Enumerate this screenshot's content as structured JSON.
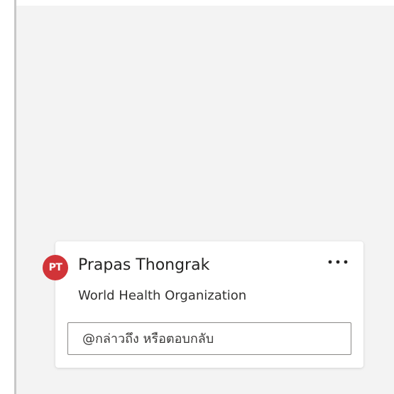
{
  "comment": {
    "avatar_initials": "PT",
    "avatar_color": "#d13438",
    "author": "Prapas Thongrak",
    "organization": "World Health Organization",
    "more_icon": "more-horizontal-icon",
    "reply": {
      "placeholder": "@กล่าวถึง หรือตอบกลับ",
      "value": ""
    }
  }
}
